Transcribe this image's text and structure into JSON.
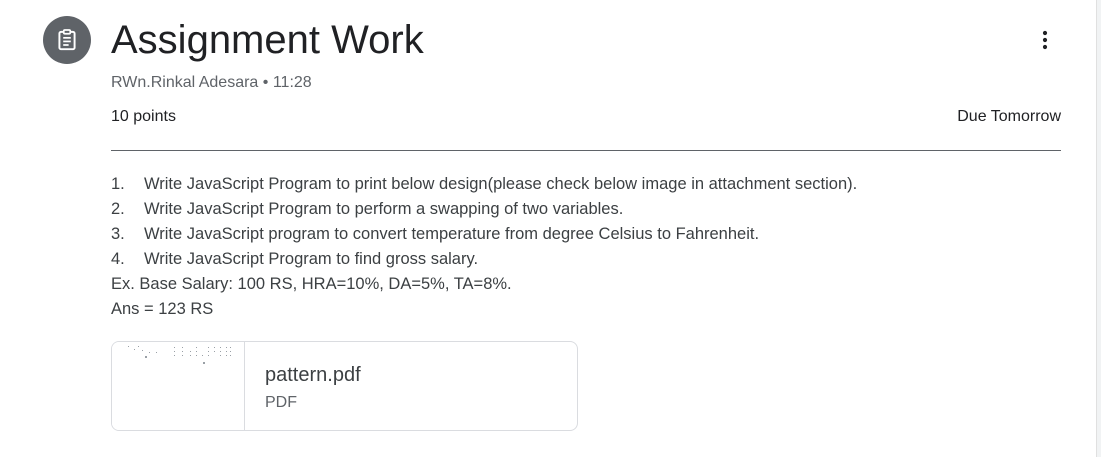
{
  "header": {
    "title": "Assignment Work",
    "icon": "assignment-icon",
    "author": "RWn.Rinkal Adesara",
    "separator": "•",
    "time": "11:28",
    "more_icon": "more-vert-icon"
  },
  "details": {
    "points": "10 points",
    "due": "Due Tomorrow"
  },
  "instructions": {
    "items": [
      {
        "num": "1.",
        "text": "Write JavaScript Program to print below design(please check below image in attachment section)."
      },
      {
        "num": "2.",
        "text": "Write JavaScript Program to perform a swapping of two variables."
      },
      {
        "num": "3.",
        "text": "Write JavaScript program to convert temperature from degree Celsius to Fahrenheit."
      },
      {
        "num": "4.",
        "text": "Write JavaScript Program to find gross salary."
      }
    ],
    "example": "Ex. Base Salary: 100 RS, HRA=10%, DA=5%, TA=8%.",
    "answer": "Ans = 123 RS"
  },
  "attachment": {
    "name": "pattern.pdf",
    "type": "PDF",
    "thumbnail_icon": "pdf-thumbnail"
  },
  "colors": {
    "icon_bg": "#5f6368",
    "title": "#202124",
    "text": "#3c4043",
    "muted": "#5f6368",
    "border": "#dadce0"
  }
}
